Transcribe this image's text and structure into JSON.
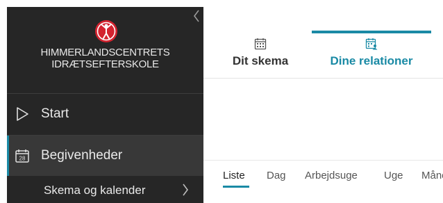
{
  "sidebar": {
    "school_name_line1": "HIMMERLANDSCENTRETS",
    "school_name_line2": "IDRÆTSEFTERSKOLE",
    "items": [
      {
        "label": "Start",
        "icon": "play-outline-icon"
      },
      {
        "label": "Begivenheder",
        "icon": "calendar-icon",
        "icon_text": "28",
        "active": true
      }
    ],
    "subitem": {
      "label": "Skema og kalender",
      "icon": "chevron-right-icon"
    }
  },
  "tabs": [
    {
      "label": "Dit skema",
      "icon": "calendar-grid-icon"
    },
    {
      "label": "Dine relationer",
      "icon": "calendar-people-icon",
      "active": true
    }
  ],
  "view_tabs": [
    "Liste",
    "Dag",
    "Arbejdsuge",
    "Uge",
    "Måned"
  ],
  "colors": {
    "accent": "#1a8aa5",
    "sidebar_bg": "#262626",
    "logo_red": "#d3232f"
  }
}
